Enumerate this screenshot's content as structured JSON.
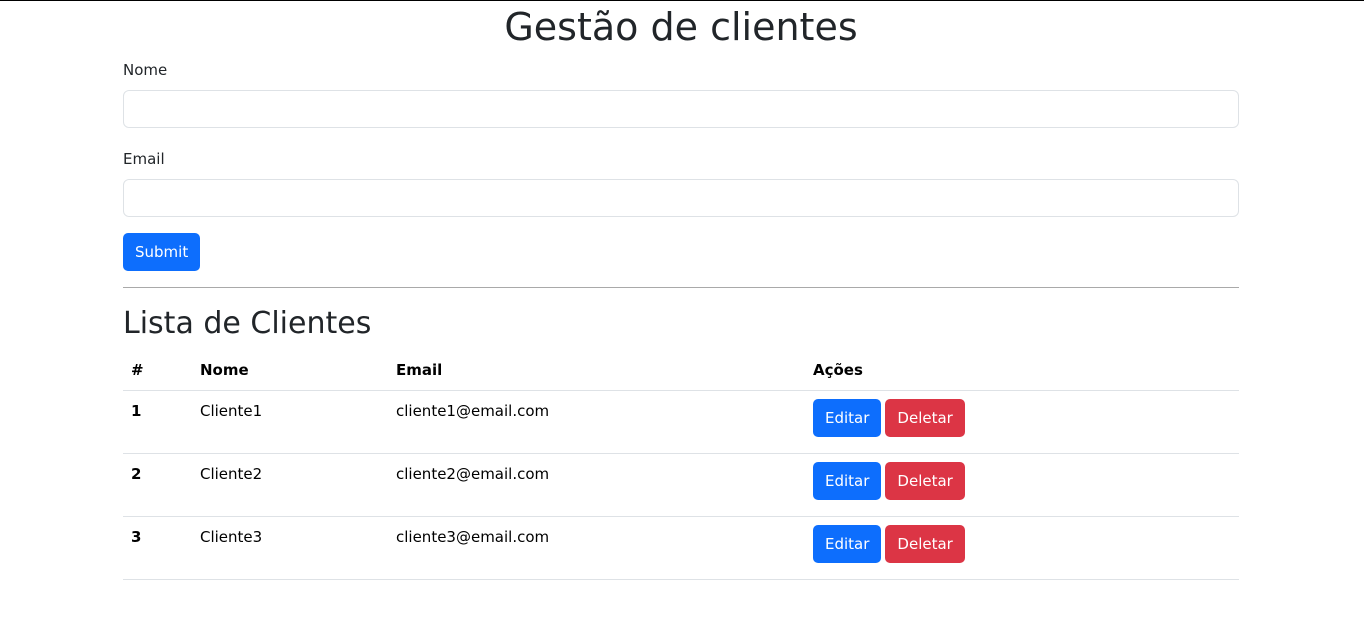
{
  "page": {
    "title": "Gestão de clientes"
  },
  "form": {
    "nome_label": "Nome",
    "nome_value": "",
    "email_label": "Email",
    "email_value": "",
    "submit_label": "Submit"
  },
  "list": {
    "title": "Lista de Clientes",
    "headers": {
      "idx": "#",
      "nome": "Nome",
      "email": "Email",
      "acoes": "Ações"
    },
    "rows": [
      {
        "idx": "1",
        "nome": "Cliente1",
        "email": "cliente1@email.com",
        "edit_label": "Editar",
        "delete_label": "Deletar"
      },
      {
        "idx": "2",
        "nome": "Cliente2",
        "email": "cliente2@email.com",
        "edit_label": "Editar",
        "delete_label": "Deletar"
      },
      {
        "idx": "3",
        "nome": "Cliente3",
        "email": "cliente3@email.com",
        "edit_label": "Editar",
        "delete_label": "Deletar"
      }
    ]
  },
  "colors": {
    "primary": "#0d6efd",
    "danger": "#dc3545"
  }
}
